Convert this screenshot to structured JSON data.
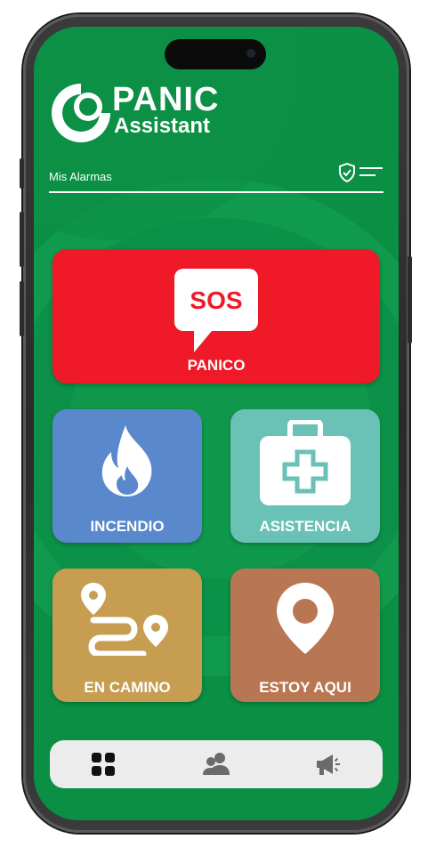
{
  "app": {
    "brand_title": "PANIC",
    "brand_subtitle": "Assistant"
  },
  "header": {
    "section_label": "Mis Alarmas",
    "icons": [
      "shield-check-icon",
      "menu-icon"
    ]
  },
  "tiles": {
    "panic": {
      "label": "PANICO",
      "badge_text": "SOS",
      "color": "#f01927",
      "icon": "sos-speech-bubble-icon"
    },
    "fire": {
      "label": "INCENDIO",
      "color": "#5a88cc",
      "icon": "flame-icon"
    },
    "assist": {
      "label": "ASISTENCIA",
      "color": "#6ac1b6",
      "icon": "first-aid-kit-icon"
    },
    "onway": {
      "label": "EN CAMINO",
      "color": "#c79d52",
      "icon": "route-icon"
    },
    "here": {
      "label": "ESTOY AQUI",
      "color": "#b97653",
      "icon": "location-pin-icon"
    }
  },
  "bottom_nav": {
    "items": [
      {
        "icon": "grid-icon",
        "active": true
      },
      {
        "icon": "group-icon",
        "active": false
      },
      {
        "icon": "megaphone-icon",
        "active": false
      }
    ]
  },
  "colors": {
    "background_green": "#0a8f45",
    "nav_active": "#111111",
    "nav_inactive": "#6a6a6a"
  }
}
